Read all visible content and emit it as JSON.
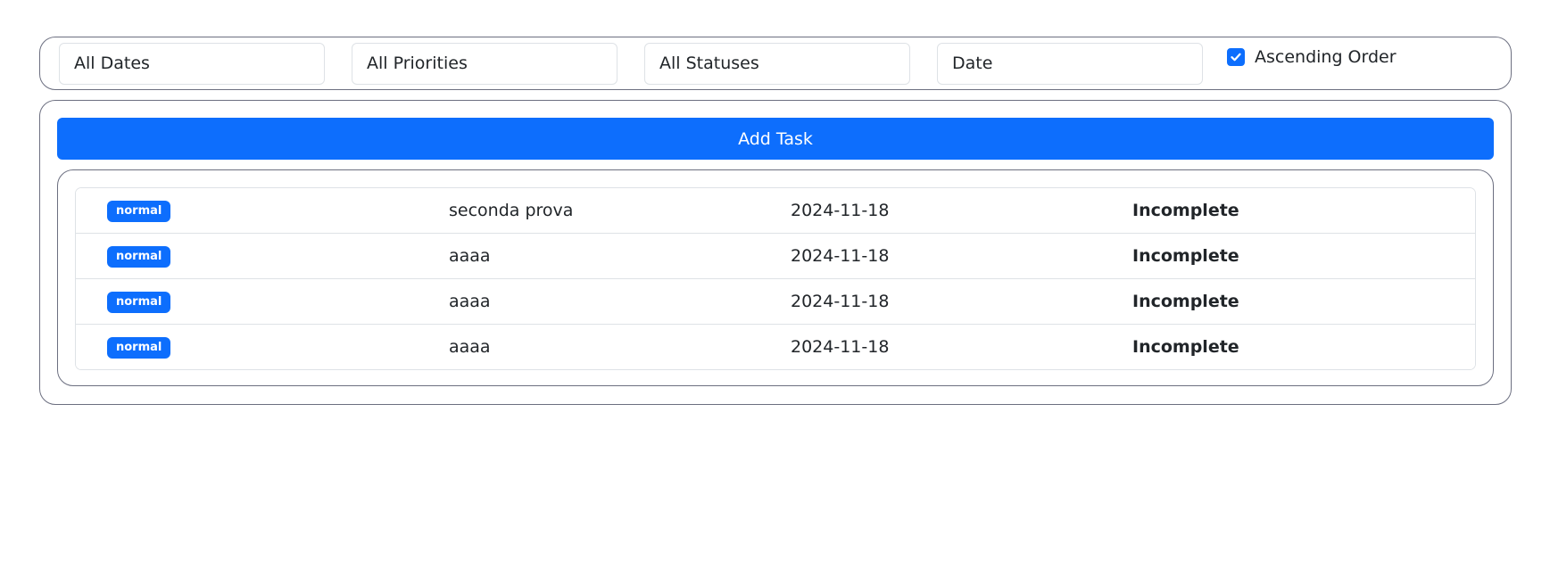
{
  "filters": {
    "date_select": "All Dates",
    "priority_select": "All Priorities",
    "status_select": "All Statuses",
    "sort_select": "Date",
    "ascending_order": {
      "label": "Ascending Order",
      "checked": true
    }
  },
  "actions": {
    "add_task_label": "Add Task"
  },
  "tasks": [
    {
      "priority": "normal",
      "title": "seconda prova",
      "date": "2024-11-18",
      "status": "Incomplete"
    },
    {
      "priority": "normal",
      "title": "aaaa",
      "date": "2024-11-18",
      "status": "Incomplete"
    },
    {
      "priority": "normal",
      "title": "aaaa",
      "date": "2024-11-18",
      "status": "Incomplete"
    },
    {
      "priority": "normal",
      "title": "aaaa",
      "date": "2024-11-18",
      "status": "Incomplete"
    }
  ],
  "colors": {
    "accent": "#0d6efd",
    "panel_border": "#6c6f80",
    "field_border": "#dee2e6",
    "text": "#212529"
  },
  "icons": {
    "checkbox_mark": "check-icon"
  }
}
